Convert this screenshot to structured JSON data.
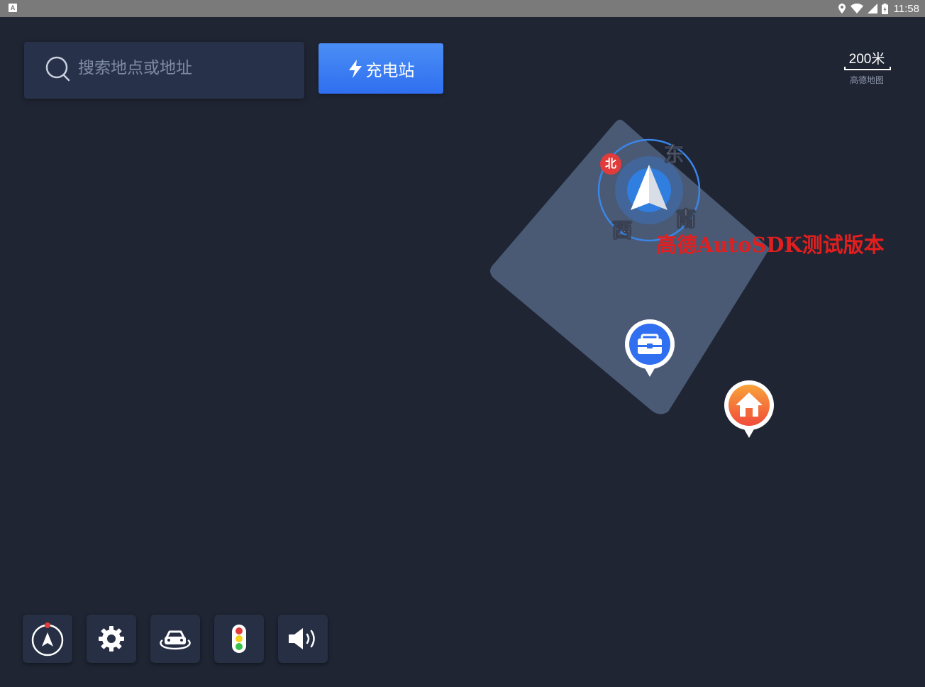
{
  "status_bar": {
    "time": "11:58",
    "left_icon": "A",
    "icons": [
      "location-icon",
      "wifi-icon",
      "signal-icon",
      "battery-icon"
    ]
  },
  "search": {
    "placeholder": "搜索地点或地址",
    "icon": "search-icon"
  },
  "charge_button": {
    "label": "充电站",
    "icon": "lightning-icon",
    "color": "#3a7cf2"
  },
  "scale": {
    "value": "200米",
    "logo": "高德地图"
  },
  "compass": {
    "north": "北",
    "east": "东",
    "south": "南",
    "west": "西"
  },
  "watermark": "高德AutoSDK测试版本",
  "markers": [
    {
      "name": "company-marker",
      "icon": "briefcase-icon",
      "color": "#2f6ff0"
    },
    {
      "name": "home-marker",
      "icon": "home-icon",
      "color": "#f25a3a"
    }
  ],
  "toolbar": [
    {
      "name": "compass-button",
      "icon": "compass-icon"
    },
    {
      "name": "settings-button",
      "icon": "gear-icon"
    },
    {
      "name": "car-view-button",
      "icon": "car-icon"
    },
    {
      "name": "traffic-button",
      "icon": "traffic-light-icon"
    },
    {
      "name": "volume-button",
      "icon": "speaker-icon"
    }
  ],
  "colors": {
    "background": "#1f2533",
    "map_area": "#4a5a75",
    "accent": "#3a7cf2",
    "watermark": "#e21f1f"
  }
}
